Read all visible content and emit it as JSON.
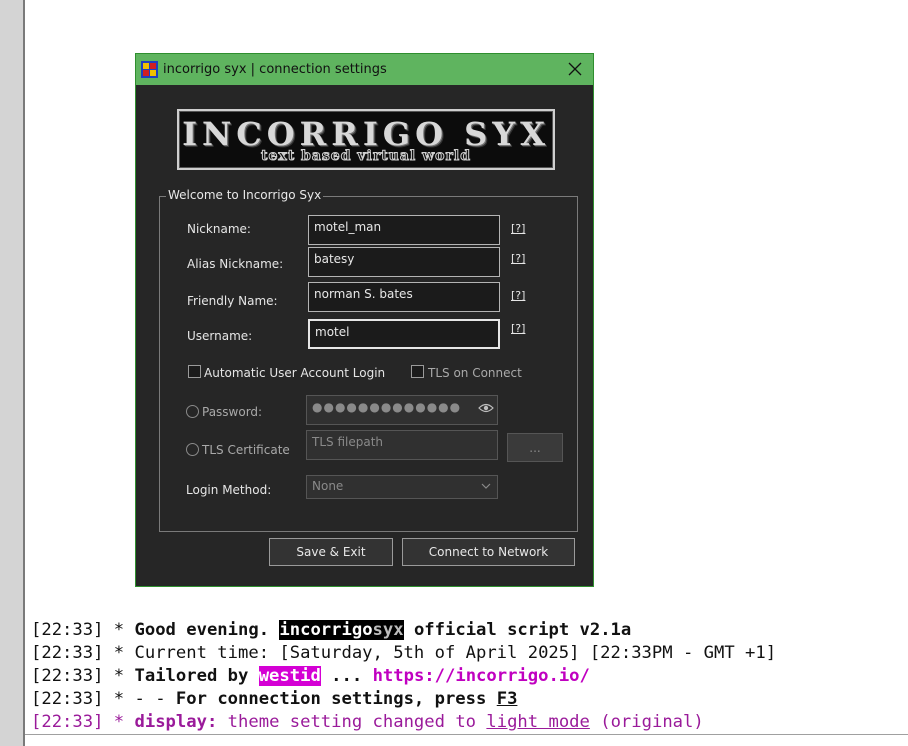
{
  "window": {
    "title": "incorrigo syx | connection settings"
  },
  "banner": {
    "title": "INCORRIGO SYX",
    "subtitle": "text based virtual world"
  },
  "group": {
    "legend": "Welcome to Incorrigo Syx"
  },
  "fields": {
    "nickname": {
      "label": "Nickname:",
      "value": "motel_man",
      "help": "[?]"
    },
    "alias": {
      "label": "Alias Nickname:",
      "value": "batesy",
      "help": "[?]"
    },
    "friendly": {
      "label": "Friendly Name:",
      "value": "norman S. bates",
      "help": "[?]"
    },
    "username": {
      "label": "Username:",
      "value": "motel",
      "help": "[?]"
    }
  },
  "options": {
    "auto_login": {
      "label": "Automatic User Account Login",
      "checked": false
    },
    "tls_connect": {
      "label": "TLS on Connect",
      "checked": false
    }
  },
  "auth": {
    "password_label": "Password:",
    "password_value": "●●●●●●●●●●●●●",
    "tls_cert_label": "TLS Certificate",
    "tls_placeholder": "TLS filepath",
    "browse_label": "...",
    "login_method_label": "Login Method:",
    "login_method_value": "None"
  },
  "buttons": {
    "save_exit": "Save & Exit",
    "connect": "Connect to Network"
  },
  "console": {
    "lines": [
      {
        "time": "[22:33]",
        "star": "*",
        "parts": [
          "Good evening.",
          "incorrigo",
          "syx",
          "official script v2.1a"
        ]
      },
      {
        "time": "[22:33]",
        "star": "*",
        "parts": [
          "Current time: [Saturday, 5th of April 2025] [22:33PM - GMT +1]"
        ]
      },
      {
        "time": "[22:33]",
        "star": "*",
        "parts": [
          "Tailored by",
          "westid",
          "...",
          "https://incorrigo.io/"
        ]
      },
      {
        "time": "[22:33]",
        "star": "*",
        "parts": [
          "- -",
          "For connection settings, press",
          "F3"
        ]
      },
      {
        "time": "[22:33]",
        "star": "*",
        "parts": [
          "display:",
          "theme setting changed to",
          "light mode",
          "(original)"
        ]
      }
    ]
  },
  "colors": {
    "titlebar": "#5fb45f",
    "dialog_bg": "#262626",
    "highlight_magenta": "#d400d4",
    "link_magenta": "#c000c0",
    "system_purple": "#9a1a9a"
  }
}
